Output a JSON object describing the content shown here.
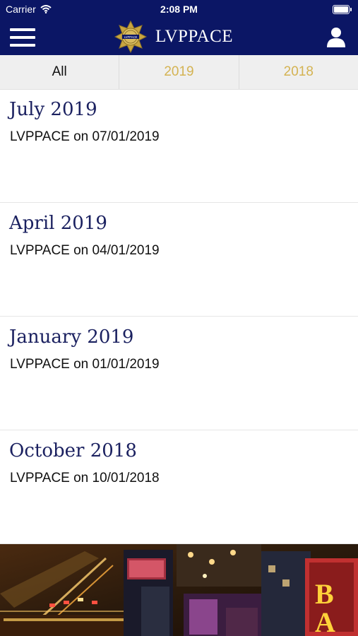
{
  "status_bar": {
    "carrier": "Carrier",
    "time": "2:08 PM"
  },
  "header": {
    "title": "LVPPACE",
    "badge_text": "LVPPACE"
  },
  "tabs": [
    {
      "label": "All",
      "selected": true
    },
    {
      "label": "2019",
      "selected": false
    },
    {
      "label": "2018",
      "selected": false
    }
  ],
  "items": [
    {
      "title": "July 2019",
      "subtitle": "LVPPACE on 07/01/2019"
    },
    {
      "title": "April 2019",
      "subtitle": "LVPPACE on 04/01/2019"
    },
    {
      "title": "January 2019",
      "subtitle": "LVPPACE on 01/01/2019"
    },
    {
      "title": "October 2018",
      "subtitle": "LVPPACE on 10/01/2018"
    }
  ],
  "colors": {
    "header_bg": "#0b1665",
    "tab_bg": "#efefef",
    "tab_inactive": "#d4b352",
    "title_navy": "#1b2160"
  },
  "icons": [
    "wifi-icon",
    "battery-icon",
    "menu-icon",
    "badge-logo-icon",
    "user-icon"
  ]
}
